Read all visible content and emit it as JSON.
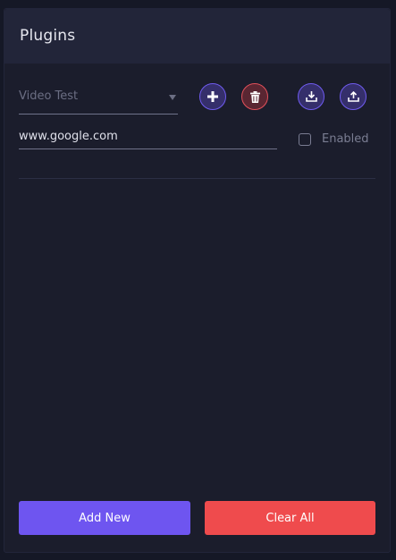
{
  "header": {
    "title": "Plugins"
  },
  "plugin_select": {
    "value": "Video Test"
  },
  "toolbar": {
    "add_icon": "plus-icon",
    "delete_icon": "trash-icon",
    "download_icon": "download-icon",
    "upload_icon": "upload-icon"
  },
  "url_field": {
    "value": "www.google.com"
  },
  "enabled_checkbox": {
    "label": "Enabled",
    "checked": false
  },
  "footer": {
    "add_new_label": "Add New",
    "clear_all_label": "Clear All"
  },
  "colors": {
    "background": "#1b1d2c",
    "header": "#222539",
    "accent": "#6e55f0",
    "danger": "#ef4b4d"
  }
}
